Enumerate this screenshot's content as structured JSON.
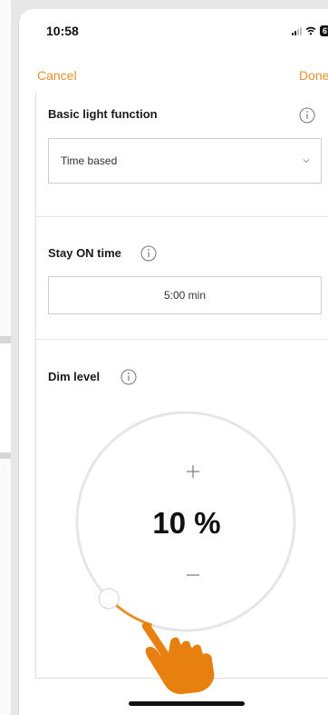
{
  "status_bar": {
    "time": "10:58",
    "battery": "67"
  },
  "nav": {
    "cancel_label": "Cancel",
    "done_label": "Done"
  },
  "basic_light": {
    "label": "Basic light function",
    "value": "Time based"
  },
  "stay_on": {
    "label": "Stay ON time",
    "value": "5:00 min"
  },
  "dim": {
    "label": "Dim level",
    "value_text": "10 %",
    "level_fraction": 0.1
  },
  "colors": {
    "accent": "#e8912a",
    "hand": "#e8800f",
    "border": "#cfcfcf"
  },
  "icons": [
    "info-icon",
    "chevron-down-icon",
    "plus-icon",
    "minus-icon",
    "tap-hand-icon"
  ]
}
